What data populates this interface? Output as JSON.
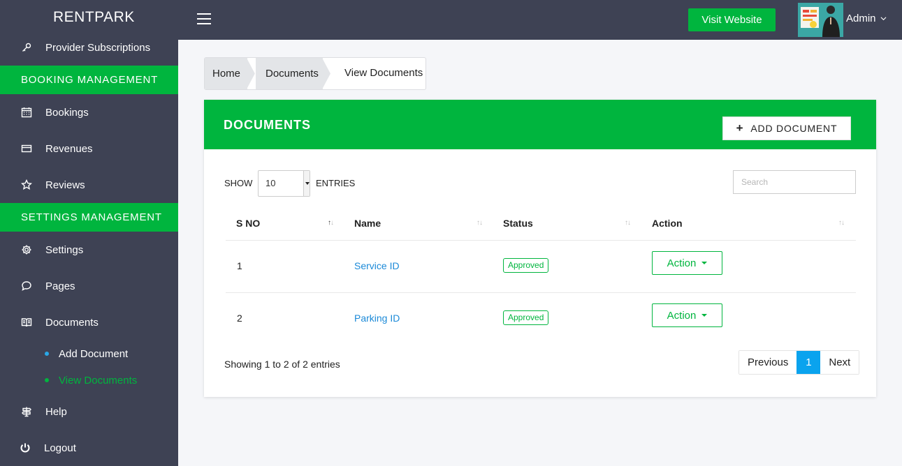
{
  "brand": "RENTPARK",
  "sidebar": {
    "top_item": {
      "label": "Provider Subscriptions",
      "icon": "key-icon"
    },
    "booking_section": "BOOKING MANAGEMENT",
    "booking_items": [
      {
        "label": "Bookings",
        "icon": "calendar-icon"
      },
      {
        "label": "Revenues",
        "icon": "credit-card-icon"
      },
      {
        "label": "Reviews",
        "icon": "star-icon"
      }
    ],
    "settings_section": "SETTINGS MANAGEMENT",
    "settings_items": [
      {
        "label": "Settings",
        "icon": "gear-icon"
      },
      {
        "label": "Pages",
        "icon": "chat-icon"
      },
      {
        "label": "Documents",
        "icon": "book-icon"
      }
    ],
    "documents_sub": [
      {
        "label": "Add Document"
      },
      {
        "label": "View Documents"
      }
    ],
    "help": {
      "label": "Help",
      "icon": "signpost-icon"
    },
    "logout": {
      "label": "Logout",
      "icon": "power-icon"
    }
  },
  "topbar": {
    "visit_label": "Visit Website",
    "user_name": "Admin"
  },
  "breadcrumb": [
    "Home",
    "Documents",
    "View Documents"
  ],
  "card": {
    "title": "DOCUMENTS",
    "add_label": "ADD DOCUMENT",
    "show_label": "SHOW",
    "entries_value": "10",
    "entries_label": "ENTRIES",
    "search_placeholder": "Search",
    "columns": [
      "S NO",
      "Name",
      "Status",
      "Action"
    ],
    "rows": [
      {
        "sno": "1",
        "name": "Service ID",
        "status": "Approved",
        "action": "Action"
      },
      {
        "sno": "2",
        "name": "Parking ID",
        "status": "Approved",
        "action": "Action"
      }
    ],
    "showing": "Showing 1 to 2 of 2 entries",
    "pager": {
      "prev": "Previous",
      "current": "1",
      "next": "Next"
    }
  },
  "colors": {
    "accent": "#00b53e",
    "sidebar": "#3e4254",
    "link": "#1c8ad8",
    "page_active": "#0aa3ee"
  }
}
